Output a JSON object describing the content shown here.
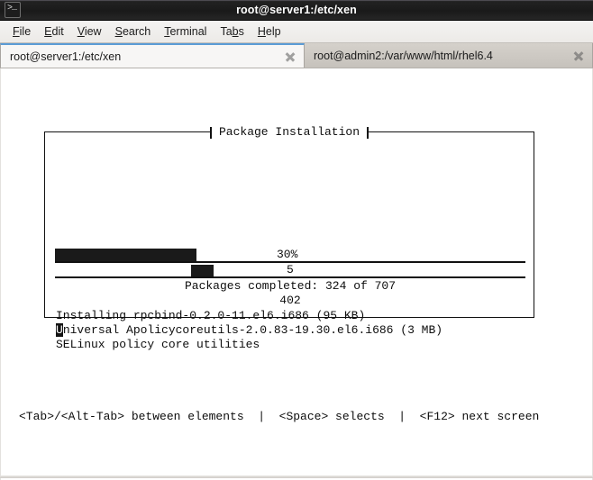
{
  "window": {
    "title": "root@server1:/etc/xen",
    "icon": "terminal-icon"
  },
  "menubar": {
    "items": [
      {
        "label": "File",
        "mnemonic": "F"
      },
      {
        "label": "Edit",
        "mnemonic": "E"
      },
      {
        "label": "View",
        "mnemonic": "V"
      },
      {
        "label": "Search",
        "mnemonic": "S"
      },
      {
        "label": "Terminal",
        "mnemonic": "T"
      },
      {
        "label": "Tabs",
        "mnemonic": "b"
      },
      {
        "label": "Help",
        "mnemonic": "H"
      }
    ]
  },
  "tabs": [
    {
      "label": "root@server1:/etc/xen",
      "active": true,
      "close_icon": "close-icon"
    },
    {
      "label": "root@admin2:/var/www/html/rhel6.4",
      "active": false,
      "close_icon": "close-icon"
    }
  ],
  "terminal": {
    "dialog": {
      "title": "Package Installation",
      "progress_primary": {
        "percent_label": "30%",
        "percent_value": 30
      },
      "progress_secondary": {
        "value_label": "5",
        "percent_value": 5
      },
      "packages_completed": "Packages completed: 324 of 707",
      "bytes_line": "402",
      "installing_line": "Installing rpcbind-0.2.0-11.el6.i686 (95 KB)",
      "current_line_cursor_char": "U",
      "current_line_rest": "niversal Apolicycoreutils-2.0.83-19.30.el6.i686 (3 MB)",
      "description_line": "SELinux policy core utilities"
    },
    "hint_line": "<Tab>/<Alt-Tab> between elements  |  <Space> selects  |  <F12> next screen"
  },
  "colors": {
    "terminal_bg": "#ffffff",
    "terminal_fg": "#0d0d0d",
    "titlebar_bg": "#1a1a1a",
    "active_tab_accent": "#5b9bd5"
  }
}
